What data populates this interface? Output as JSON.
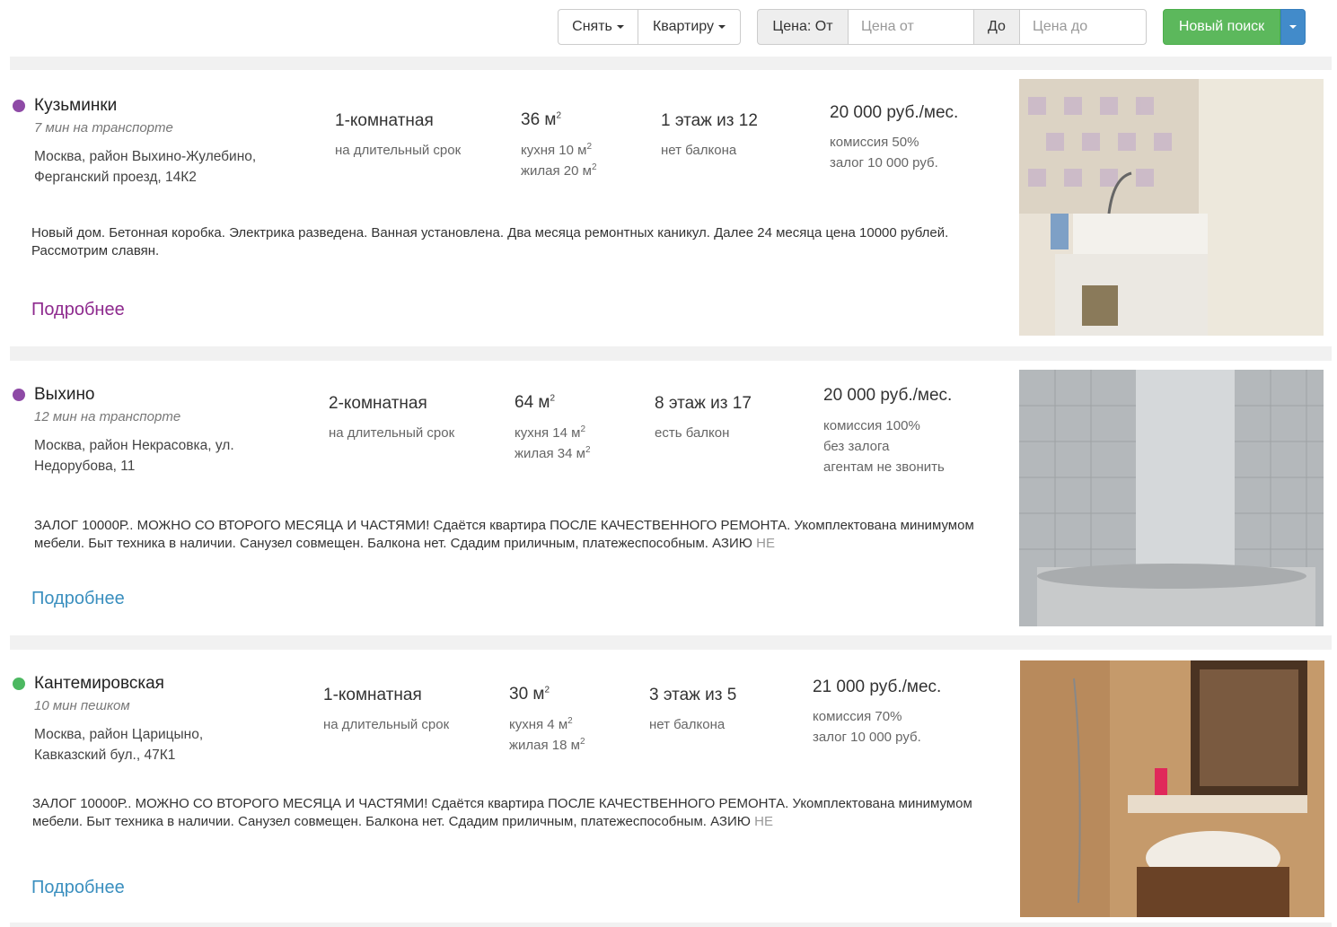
{
  "toolbar": {
    "deal_label": "Снять",
    "type_label": "Квартиру",
    "price_from_prefix": "Цена: От",
    "price_from_placeholder": "Цена от",
    "price_to_prefix": "До",
    "price_to_placeholder": "Цена до",
    "new_search_label": "Новый поиск"
  },
  "colors": {
    "metro_purple": "#8e4aa6",
    "metro_green": "#4cb861",
    "link_visited": "#8e2a8e",
    "link": "#3a8fbf",
    "button_green": "#5cb85c",
    "button_blue": "#428bca"
  },
  "listings": [
    {
      "station": "Кузьминки",
      "transit": "7 мин на транспорте",
      "address_line1": "Москва, район Выхино-Жулебино,",
      "address_line2": "Ферганский проезд, 14К2",
      "rooms": "1-комнатная",
      "term": "на длительный срок",
      "area": "36 м",
      "kitchen": "кухня 10 м",
      "living": "жилая 20 м",
      "floor": "1 этаж из 12",
      "balcony": "нет балкона",
      "price": "20 000 руб./мес.",
      "commission": "комиссия 50%",
      "deposit": "залог 10 000 руб.",
      "extra": "",
      "description": "Новый дом. Бетонная коробка. Электрика разведена. Ванная установлена. Два месяца ремонтных каникул. Далее 24 месяца цена 10000 рублей. Рассмотрим славян.",
      "description_fade": "",
      "more_label": "Подробнее",
      "photo": "kitchen-sink-photo"
    },
    {
      "station": "Выхино",
      "transit": "12 мин на транспорте",
      "address_line1": "Москва, район Некрасовка, ул.",
      "address_line2": "Недорубова, 11",
      "rooms": "2-комнатная",
      "term": "на длительный срок",
      "area": "64 м",
      "kitchen": "кухня 14 м",
      "living": "жилая 34 м",
      "floor": "8 этаж из 17",
      "balcony": "есть балкон",
      "price": "20 000 руб./мес.",
      "commission": "комиссия 100%",
      "deposit": "без залога",
      "extra": "агентам не звонить",
      "description": "ЗАЛОГ 10000Р.. МОЖНО СО ВТОРОГО МЕСЯЦА И ЧАСТЯМИ! Сдаётся квартира ПОСЛЕ КАЧЕСТВЕННОГО РЕМОНТА. Укомплектована минимумом мебели. Быт техника в наличии. Санузел совмещен. Балкона нет. Сдадим приличным, платежеспособным. АЗИЮ",
      "description_fade": " НЕ",
      "more_label": "Подробнее",
      "photo": "bathtub-photo"
    },
    {
      "station": "Кантемировская",
      "transit": "10 мин пешком",
      "address_line1": "Москва, район Царицыно,",
      "address_line2": "Кавказский бул., 47К1",
      "rooms": "1-комнатная",
      "term": "на длительный срок",
      "area": "30 м",
      "kitchen": "кухня 4 м",
      "living": "жилая 18 м",
      "floor": "3 этаж из 5",
      "balcony": "нет балкона",
      "price": "21 000 руб./мес.",
      "commission": "комиссия 70%",
      "deposit": "залог 10 000 руб.",
      "extra": "",
      "description": "ЗАЛОГ 10000Р.. МОЖНО СО ВТОРОГО МЕСЯЦА И ЧАСТЯМИ! Сдаётся квартира ПОСЛЕ КАЧЕСТВЕННОГО РЕМОНТА. Укомплектована минимумом мебели. Быт техника в наличии. Санузел совмещен. Балкона нет. Сдадим приличным, платежеспособным. АЗИЮ",
      "description_fade": " НЕ",
      "more_label": "Подробнее",
      "photo": "bathroom-sink-photo"
    }
  ]
}
